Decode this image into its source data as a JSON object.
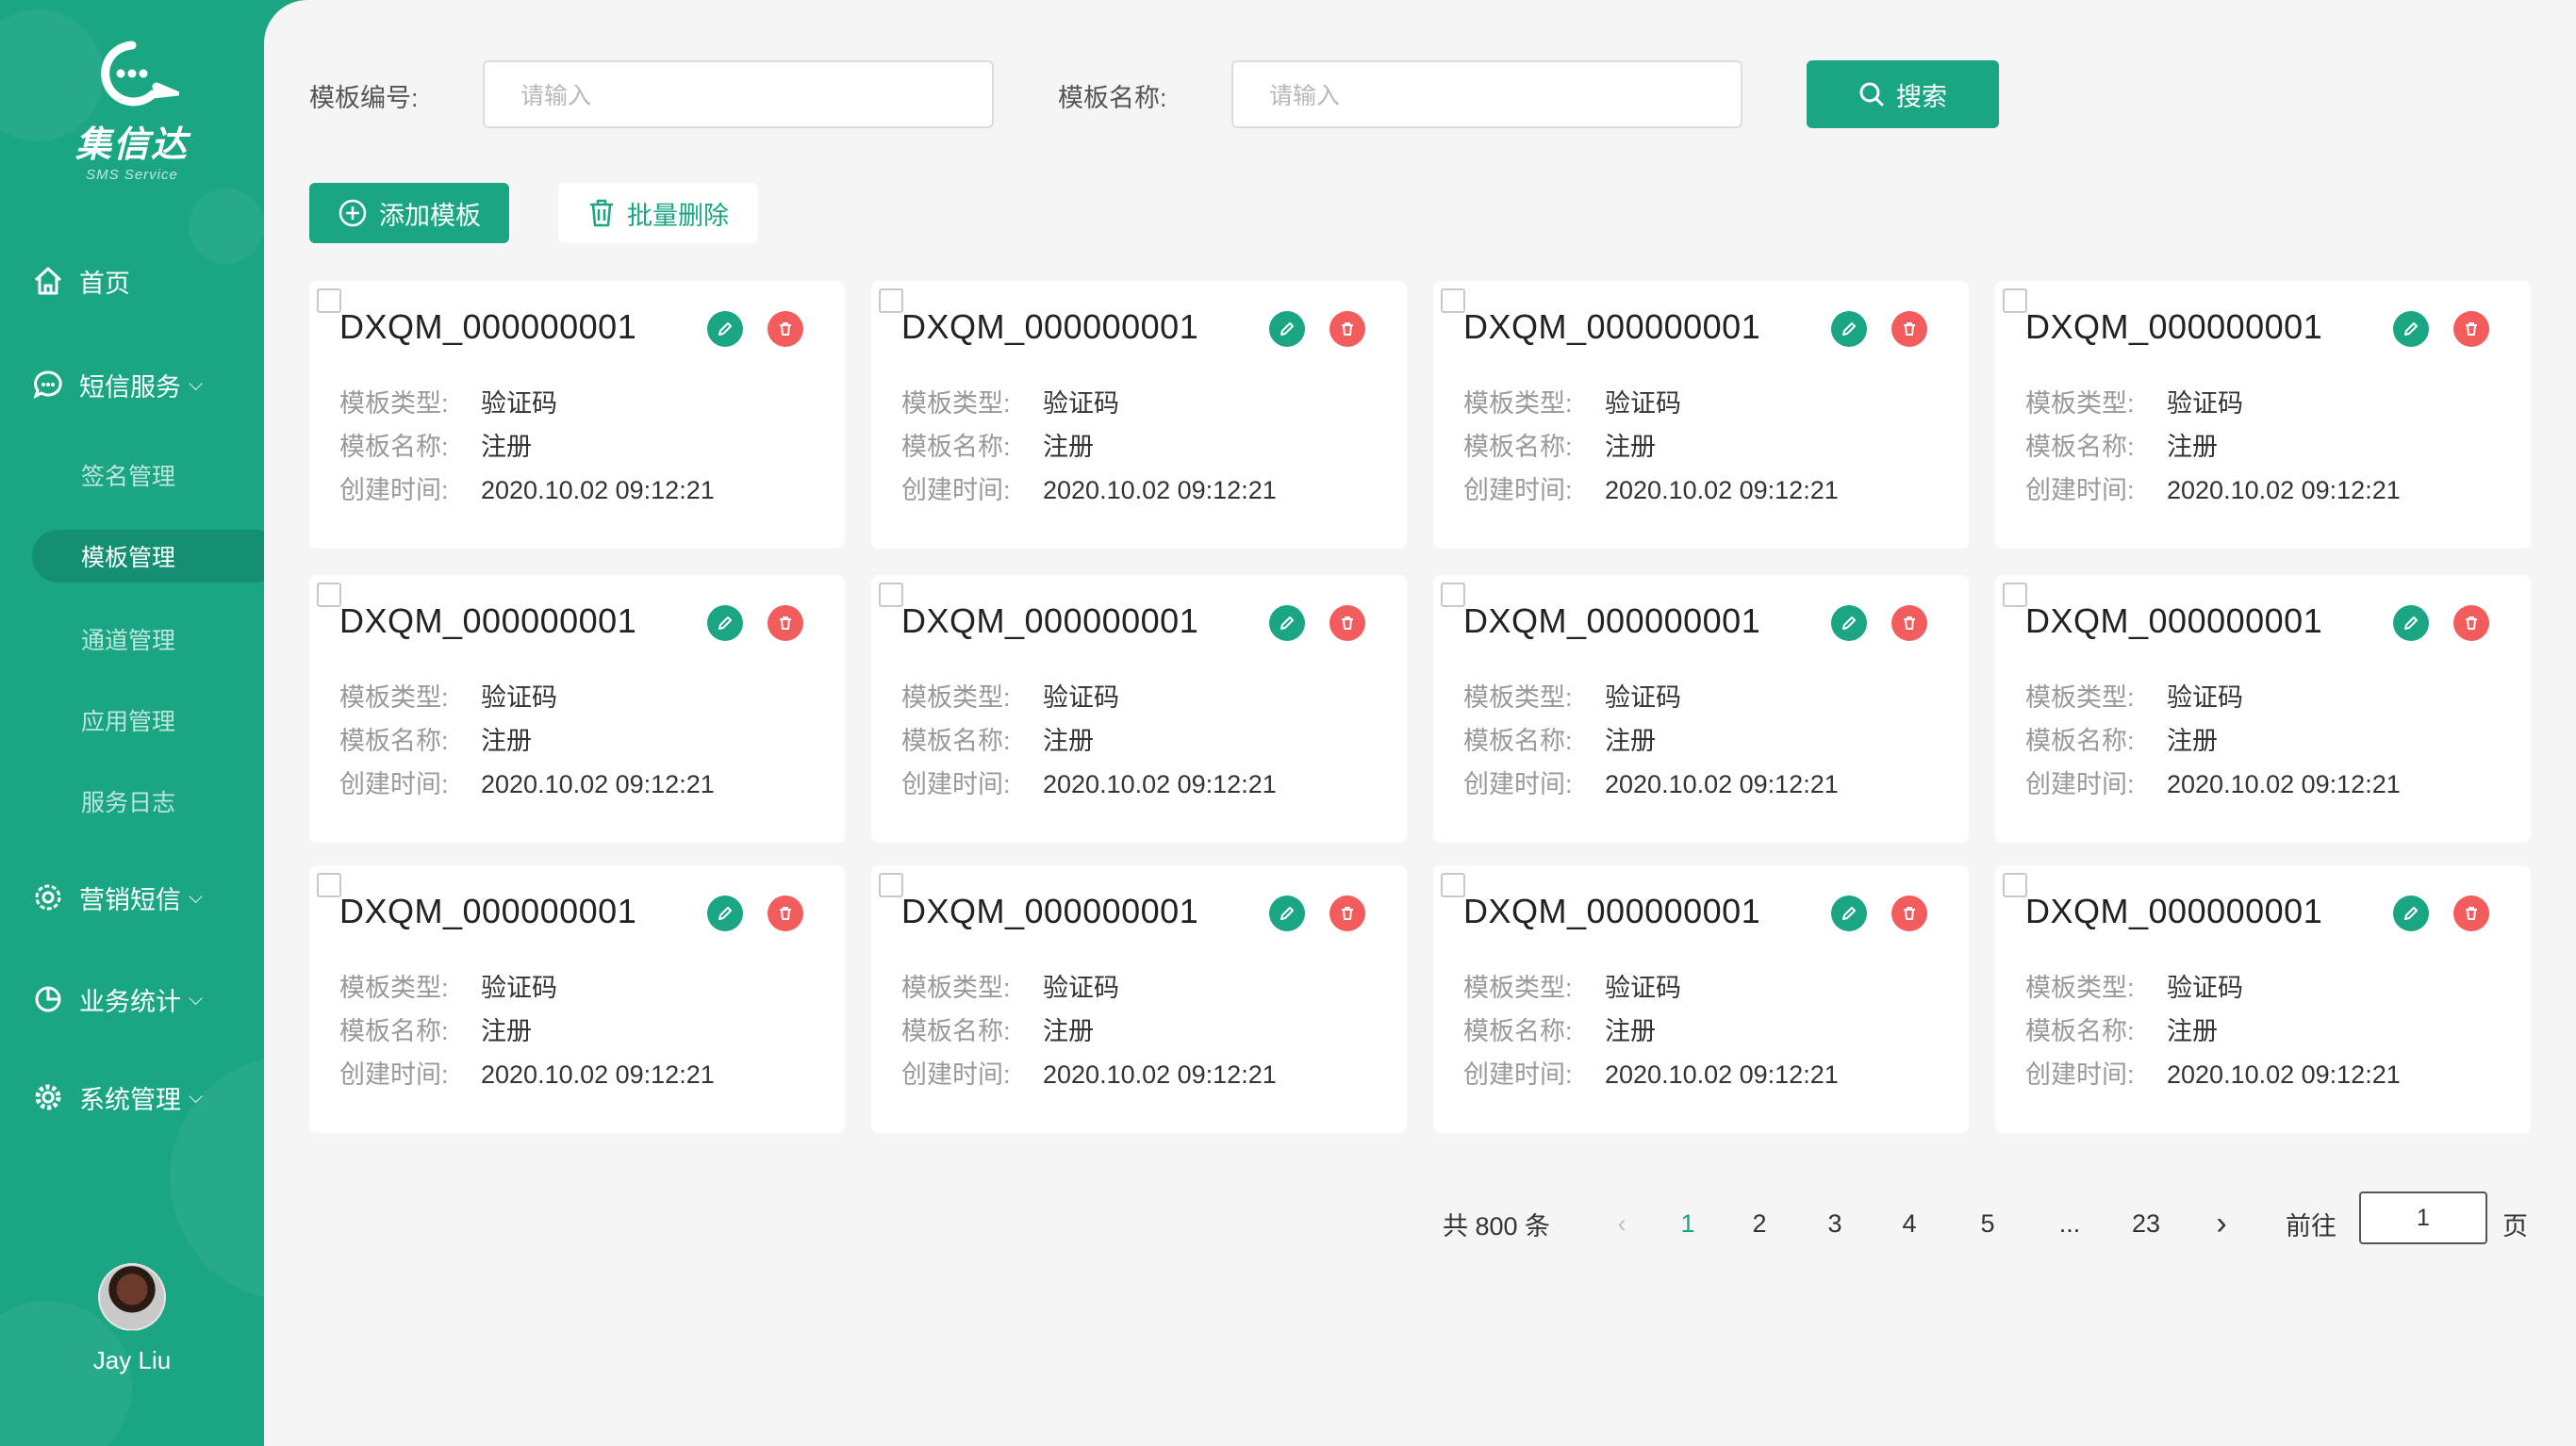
{
  "app": {
    "logo_title": "集信达",
    "logo_subtitle": "SMS Service"
  },
  "sidebar": {
    "home": "首页",
    "sms_service": "短信服务",
    "sub_items": [
      "签名管理",
      "模板管理",
      "通道管理",
      "应用管理",
      "服务日志"
    ],
    "marketing": "营销短信",
    "statistics": "业务统计",
    "system": "系统管理",
    "user_name": "Jay Liu"
  },
  "filters": {
    "code_label": "模板编号:",
    "code_placeholder": "请输入",
    "name_label": "模板名称:",
    "name_placeholder": "请输入",
    "search_label": "搜索"
  },
  "toolbar": {
    "add_label": "添加模板",
    "batch_delete_label": "批量删除"
  },
  "card_labels": {
    "type": "模板类型:",
    "name": "模板名称:",
    "created": "创建时间:"
  },
  "cards": [
    {
      "code": "DXQM_000000001",
      "type": "验证码",
      "name": "注册",
      "created": "2020.10.02  09:12:21"
    },
    {
      "code": "DXQM_000000001",
      "type": "验证码",
      "name": "注册",
      "created": "2020.10.02  09:12:21"
    },
    {
      "code": "DXQM_000000001",
      "type": "验证码",
      "name": "注册",
      "created": "2020.10.02  09:12:21"
    },
    {
      "code": "DXQM_000000001",
      "type": "验证码",
      "name": "注册",
      "created": "2020.10.02  09:12:21"
    },
    {
      "code": "DXQM_000000001",
      "type": "验证码",
      "name": "注册",
      "created": "2020.10.02  09:12:21"
    },
    {
      "code": "DXQM_000000001",
      "type": "验证码",
      "name": "注册",
      "created": "2020.10.02  09:12:21"
    },
    {
      "code": "DXQM_000000001",
      "type": "验证码",
      "name": "注册",
      "created": "2020.10.02  09:12:21"
    },
    {
      "code": "DXQM_000000001",
      "type": "验证码",
      "name": "注册",
      "created": "2020.10.02  09:12:21"
    },
    {
      "code": "DXQM_000000001",
      "type": "验证码",
      "name": "注册",
      "created": "2020.10.02  09:12:21"
    },
    {
      "code": "DXQM_000000001",
      "type": "验证码",
      "name": "注册",
      "created": "2020.10.02  09:12:21"
    },
    {
      "code": "DXQM_000000001",
      "type": "验证码",
      "name": "注册",
      "created": "2020.10.02  09:12:21"
    },
    {
      "code": "DXQM_000000001",
      "type": "验证码",
      "name": "注册",
      "created": "2020.10.02  09:12:21"
    }
  ],
  "pagination": {
    "total": "共 800 条",
    "pages": [
      "1",
      "2",
      "3",
      "4",
      "5",
      "...",
      "23"
    ],
    "current": "1",
    "goto_label": "前往",
    "goto_value": "1",
    "page_suffix": "页"
  },
  "colors": {
    "primary": "#1aa583",
    "danger": "#f25c5c",
    "background": "#f5f5f5"
  }
}
